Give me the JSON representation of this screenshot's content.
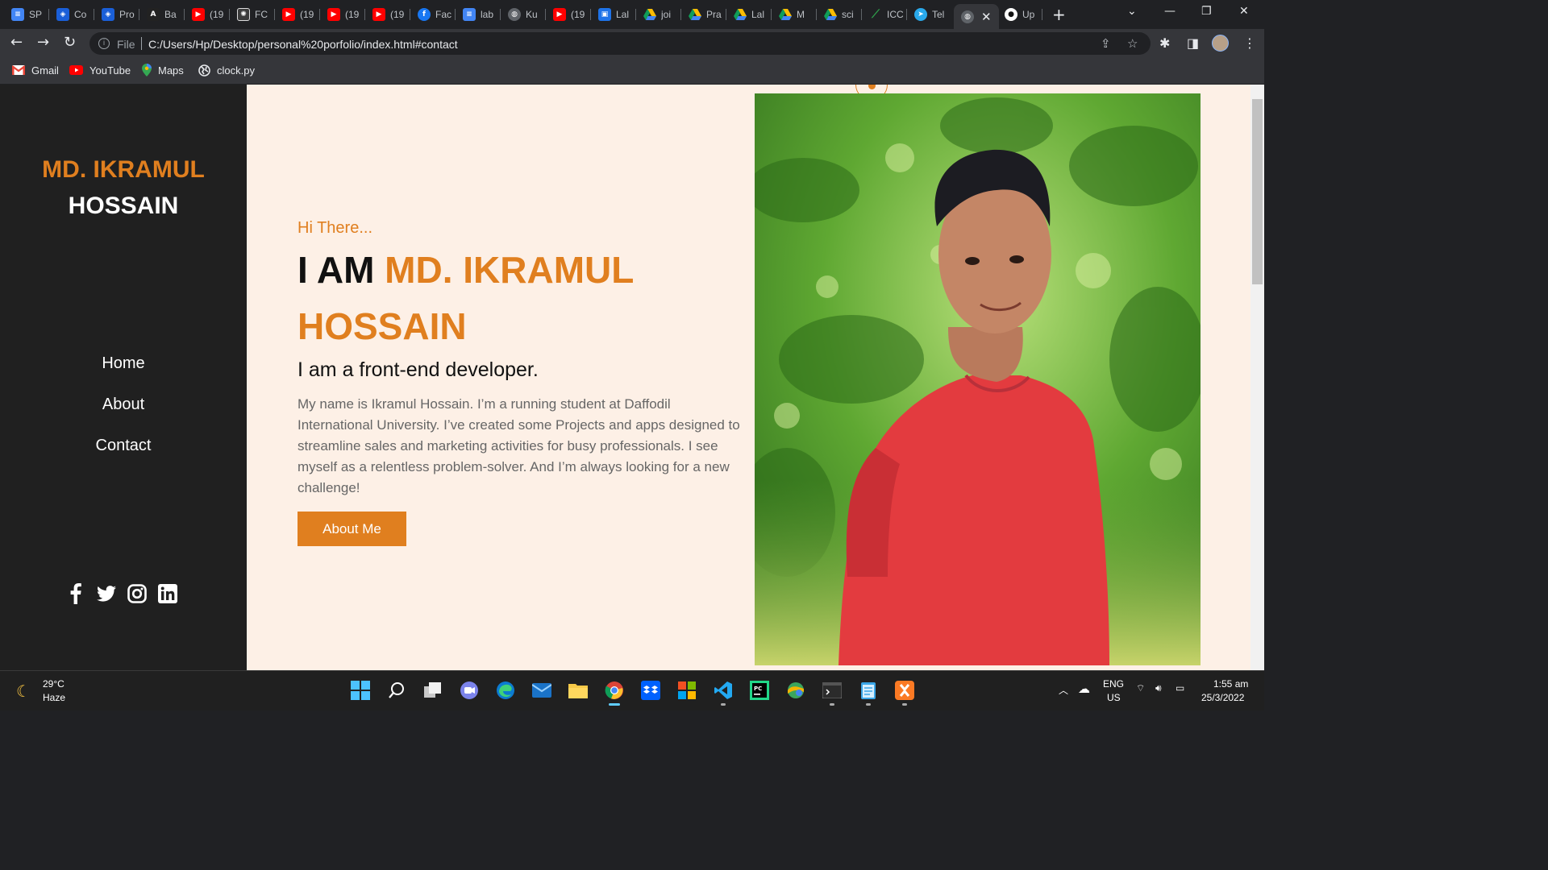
{
  "browser": {
    "tabs": [
      {
        "label": "SP",
        "icon": "docs-icon",
        "color": "#4285f4"
      },
      {
        "label": "Co",
        "icon": "codeforces-icon",
        "color": "#1a5fd8"
      },
      {
        "label": "Pro",
        "icon": "codeforces-icon",
        "color": "#1a5fd8"
      },
      {
        "label": "Ba",
        "icon": "atcoder-icon",
        "color": "#222222"
      },
      {
        "label": "(19",
        "icon": "youtube-icon",
        "color": "#ff0000"
      },
      {
        "label": "FC",
        "icon": "openai-icon",
        "color": "#3c3c3c"
      },
      {
        "label": "(19",
        "icon": "youtube-icon",
        "color": "#ff0000"
      },
      {
        "label": "(19",
        "icon": "youtube-icon",
        "color": "#ff0000"
      },
      {
        "label": "(19",
        "icon": "youtube-icon",
        "color": "#ff0000"
      },
      {
        "label": "Fac",
        "icon": "facebook-icon",
        "color": "#1877f2"
      },
      {
        "label": "lab",
        "icon": "docs-icon",
        "color": "#4285f4"
      },
      {
        "label": "Ku",
        "icon": "globe-icon",
        "color": "#5f6368"
      },
      {
        "label": "(19",
        "icon": "youtube-icon",
        "color": "#ff0000"
      },
      {
        "label": "Lal",
        "icon": "classroom-icon",
        "color": "#1e8e3e"
      },
      {
        "label": "joi",
        "icon": "drive-icon",
        "color": "#fbbc04"
      },
      {
        "label": "Pra",
        "icon": "drive-icon",
        "color": "#fbbc04"
      },
      {
        "label": "Lal",
        "icon": "drive-icon",
        "color": "#fbbc04"
      },
      {
        "label": "M",
        "icon": "drive-icon",
        "color": "#fbbc04"
      },
      {
        "label": "sci",
        "icon": "drive-icon",
        "color": "#fbbc04"
      },
      {
        "label": "ICC",
        "icon": "cricket-icon",
        "color": "#2e7d32"
      },
      {
        "label": "Tel",
        "icon": "telegram-icon",
        "color": "#29a9eb"
      },
      {
        "label": "",
        "icon": "globe-icon",
        "color": "#5f6368",
        "active": true
      },
      {
        "label": "Up",
        "icon": "github-icon",
        "color": "#ffffff"
      }
    ],
    "address": {
      "scheme_label": "File",
      "url": "C:/Users/Hp/Desktop/personal%20porfolio/index.html#contact"
    },
    "bookmarks": [
      {
        "label": "Gmail",
        "icon": "gmail-icon"
      },
      {
        "label": "YouTube",
        "icon": "youtube-icon"
      },
      {
        "label": "Maps",
        "icon": "maps-icon"
      },
      {
        "label": "clock.py",
        "icon": "globe-icon"
      }
    ]
  },
  "page": {
    "brand": {
      "first": "MD. IKRAMUL",
      "last": "HOSSAIN"
    },
    "nav": [
      "Home",
      "About",
      "Contact"
    ],
    "social": [
      "facebook-icon",
      "twitter-icon",
      "instagram-icon",
      "linkedin-icon"
    ],
    "hero": {
      "greeting": "Hi There...",
      "headline_prefix": "I AM ",
      "headline_name": "MD. IKRAMUL HOSSAIN",
      "role": "I am a front-end developer.",
      "bio": "My name is Ikramul Hossain. I’m a running student at Daffodil International University. I’ve created some Projects and apps designed to streamline sales and marketing activities for busy professionals. I see myself as a relentless problem-solver. And I’m always looking for a new challenge!",
      "button": "About Me"
    },
    "accent_color": "#e07f1f",
    "sidebar_color": "#202020",
    "background_color": "#fdf0e6"
  },
  "taskbar": {
    "weather": {
      "temp": "29°C",
      "condition": "Haze"
    },
    "apps": [
      "windows-start-icon",
      "search-icon",
      "task-view-icon",
      "teams-chat-icon",
      "edge-icon",
      "mail-icon",
      "file-explorer-icon",
      "chrome-icon",
      "dropbox-icon",
      "office-icon",
      "vscode-icon",
      "pycharm-icon",
      "photos-icon",
      "terminal-icon",
      "notepad-icon",
      "xampp-icon"
    ],
    "tray": {
      "lang_primary": "ENG",
      "lang_secondary": "US",
      "time": "1:55 am",
      "date": "25/3/2022"
    }
  }
}
